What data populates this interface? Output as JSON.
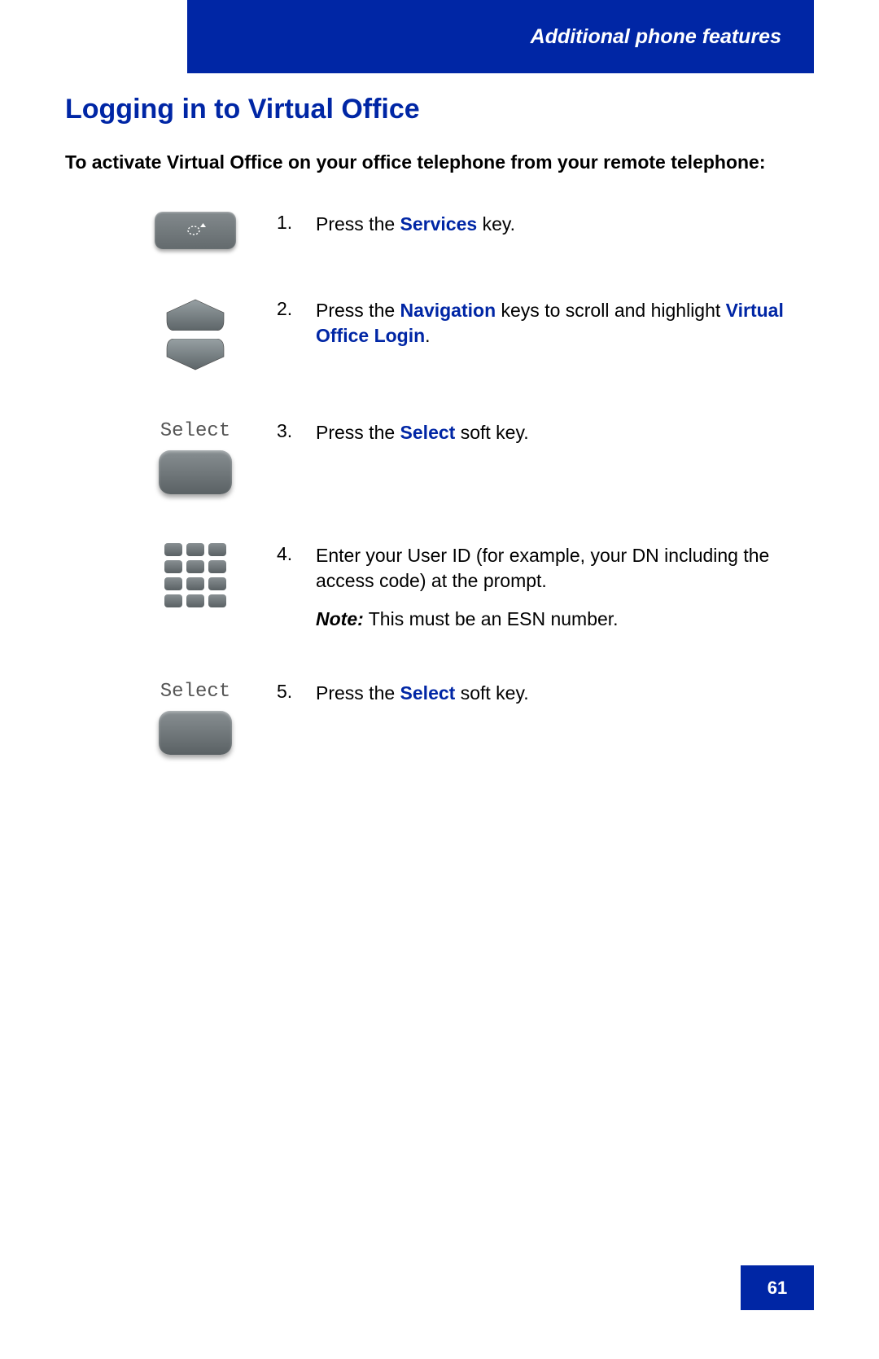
{
  "header": {
    "chapter_title": "Additional phone features"
  },
  "page": {
    "title": "Logging in to Virtual Office",
    "intro": "To activate Virtual Office on your office telephone from your remote telephone:"
  },
  "steps": [
    {
      "num": "1.",
      "parts": [
        {
          "text": "Press the ",
          "kw": false
        },
        {
          "text": "Services",
          "kw": true
        },
        {
          "text": " key.",
          "kw": false
        }
      ]
    },
    {
      "num": "2.",
      "parts": [
        {
          "text": "Press the ",
          "kw": false
        },
        {
          "text": "Navigation",
          "kw": true
        },
        {
          "text": " keys to scroll and highlight ",
          "kw": false
        },
        {
          "text": "Virtual Office Login",
          "kw": true
        },
        {
          "text": ".",
          "kw": false
        }
      ]
    },
    {
      "num": "3.",
      "select_label": "Select",
      "parts": [
        {
          "text": "Press the ",
          "kw": false
        },
        {
          "text": "Select",
          "kw": true
        },
        {
          "text": " soft key.",
          "kw": false
        }
      ]
    },
    {
      "num": "4.",
      "parts": [
        {
          "text": "Enter your User ID (for example, your DN including the access code) at the prompt.",
          "kw": false
        }
      ],
      "note_label": "Note:",
      "note_text": " This must be an ESN number."
    },
    {
      "num": "5.",
      "select_label": "Select",
      "parts": [
        {
          "text": "Press the ",
          "kw": false
        },
        {
          "text": "Select",
          "kw": true
        },
        {
          "text": " soft key.",
          "kw": false
        }
      ]
    }
  ],
  "page_number": "61"
}
